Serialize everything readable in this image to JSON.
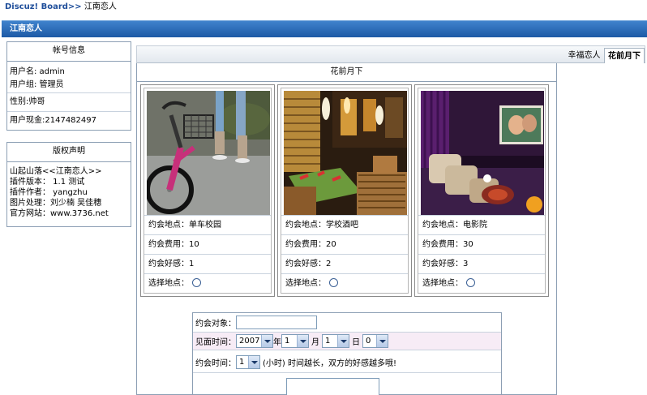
{
  "breadcrumb": {
    "home": "Discuz! Board",
    "separator": ">>",
    "current": "江南恋人"
  },
  "title_bar": {
    "title": "江南恋人"
  },
  "account_box": {
    "header": "帐号信息",
    "username": "用户名: admin",
    "usergroup": "用户组: 管理员",
    "gender": "性别:帅哥",
    "cash": "用户现金:2147482497"
  },
  "copyright_box": {
    "header": "版权声明",
    "lines": [
      "山起山落<<江南恋人>>",
      "插件版本： 1.1 测试",
      "插件作者： yangzhu",
      "图片处理：刘少楠 吴佳穗",
      "官方网站：www.3736.net"
    ]
  },
  "tabs": {
    "inactive": "幸福恋人",
    "active": "花前月下"
  },
  "panel": {
    "title": "花前月下"
  },
  "cards": [
    {
      "place": "约会地点：单车校园",
      "cost": "约会费用：10",
      "affinity": "约会好感：1",
      "choose": "选择地点：",
      "photo_icon": "bicycle-photo"
    },
    {
      "place": "约会地点：学校酒吧",
      "cost": "约会费用：20",
      "affinity": "约会好感：2",
      "choose": "选择地点：",
      "photo_icon": "bar-photo"
    },
    {
      "place": "约会地点：电影院",
      "cost": "约会费用：30",
      "affinity": "约会好感：3",
      "choose": "选择地点：",
      "photo_icon": "cinema-photo"
    }
  ],
  "form": {
    "target_label": "约会对象：",
    "meet_time_label": "见面时间：",
    "year": "2007",
    "year_suffix": "年",
    "month": "1",
    "month_suffix": "月",
    "day": "1",
    "day_suffix": "日",
    "hour": "0",
    "duration_label": "约会时间：",
    "duration": "1",
    "duration_note": "(小时) 时间越长，双方的好感越多哦!"
  }
}
